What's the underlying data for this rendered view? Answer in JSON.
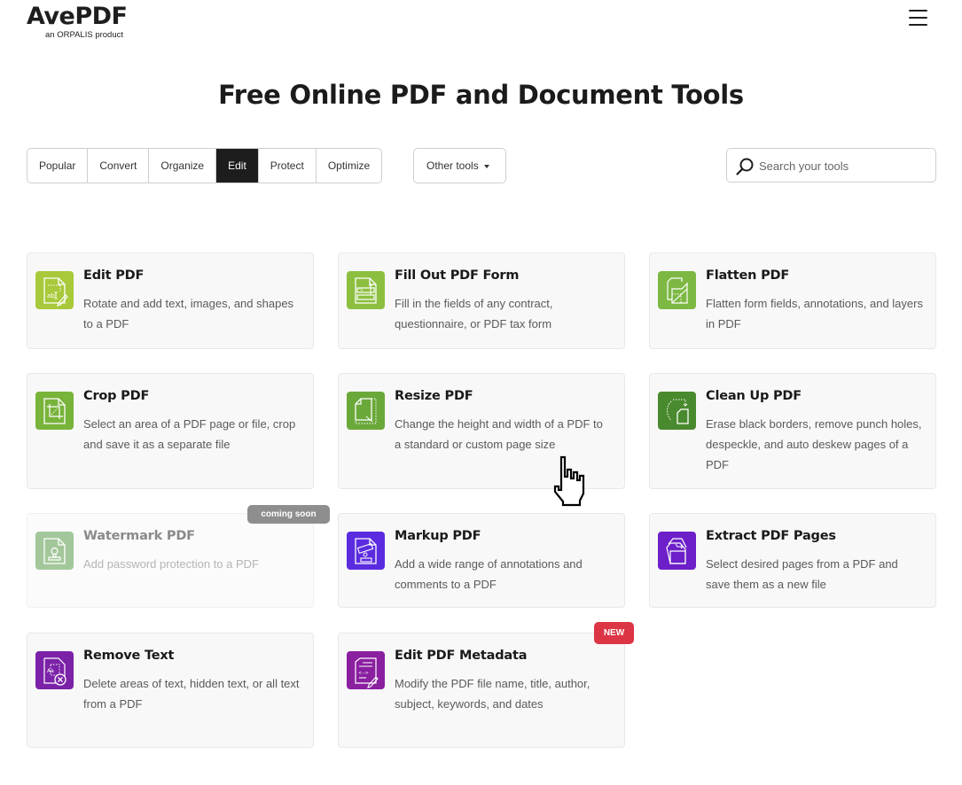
{
  "header": {
    "brand": "AvePDF",
    "brand_sub": "an ORPALIS product",
    "menu_icon": "hamburger-menu-icon"
  },
  "page_title": "Free Online PDF and Document Tools",
  "tabs": [
    {
      "label": "Popular",
      "active": false
    },
    {
      "label": "Convert",
      "active": false
    },
    {
      "label": "Organize",
      "active": false
    },
    {
      "label": "Edit",
      "active": true
    },
    {
      "label": "Protect",
      "active": false
    },
    {
      "label": "Optimize",
      "active": false
    }
  ],
  "other_tools": {
    "label": "Other tools",
    "icon": "caret-down-icon"
  },
  "search": {
    "placeholder": "Search your tools",
    "value": "",
    "icon": "search-icon"
  },
  "tools": [
    {
      "title": "Edit PDF",
      "description": "Rotate and add text, images, and shapes to a PDF",
      "icon": "edit-pdf-icon",
      "color": "#a8c93a"
    },
    {
      "title": "Fill Out PDF Form",
      "description": "Fill in the fields of any contract, questionnaire, or PDF tax form",
      "icon": "fill-form-icon",
      "color": "#8cbf3f"
    },
    {
      "title": "Flatten PDF",
      "description": "Flatten form fields, annotations, and layers in PDF",
      "icon": "flatten-icon",
      "color": "#7db843"
    },
    {
      "title": "Crop PDF",
      "description": "Select an area of a PDF page or file, crop and save it as a separate file",
      "icon": "crop-icon",
      "color": "#78b33a"
    },
    {
      "title": "Resize PDF",
      "description": "Change the height and width of a PDF to a standard or custom page size",
      "icon": "resize-icon",
      "color": "#6aa83a"
    },
    {
      "title": "Clean Up PDF",
      "description": "Erase black borders, remove punch holes, despeckle, and auto deskew pages of a PDF",
      "icon": "clean-up-icon",
      "color": "#4a8a2e"
    },
    {
      "title": "Watermark PDF",
      "description": "Add password protection to a PDF",
      "icon": "watermark-stamp-icon",
      "color": "#a3c79a",
      "disabled": true,
      "badge": "coming soon"
    },
    {
      "title": "Markup PDF",
      "description": "Add a wide range of annotations and comments to a PDF",
      "icon": "markup-icon",
      "color": "#5b2be0"
    },
    {
      "title": "Extract PDF Pages",
      "description": "Select desired pages from a PDF and save them as a new file",
      "icon": "extract-pages-icon",
      "color": "#6d1fc9"
    },
    {
      "title": "Remove Text",
      "description": "Delete areas of text, hidden text, or all text from a PDF",
      "icon": "remove-text-icon",
      "color": "#7b22a8"
    },
    {
      "title": "Edit PDF Metadata",
      "description": "Modify the PDF file name, title, author, subject, keywords, and dates",
      "icon": "metadata-icon",
      "color": "#8a1fa0",
      "badge": "NEW"
    }
  ]
}
